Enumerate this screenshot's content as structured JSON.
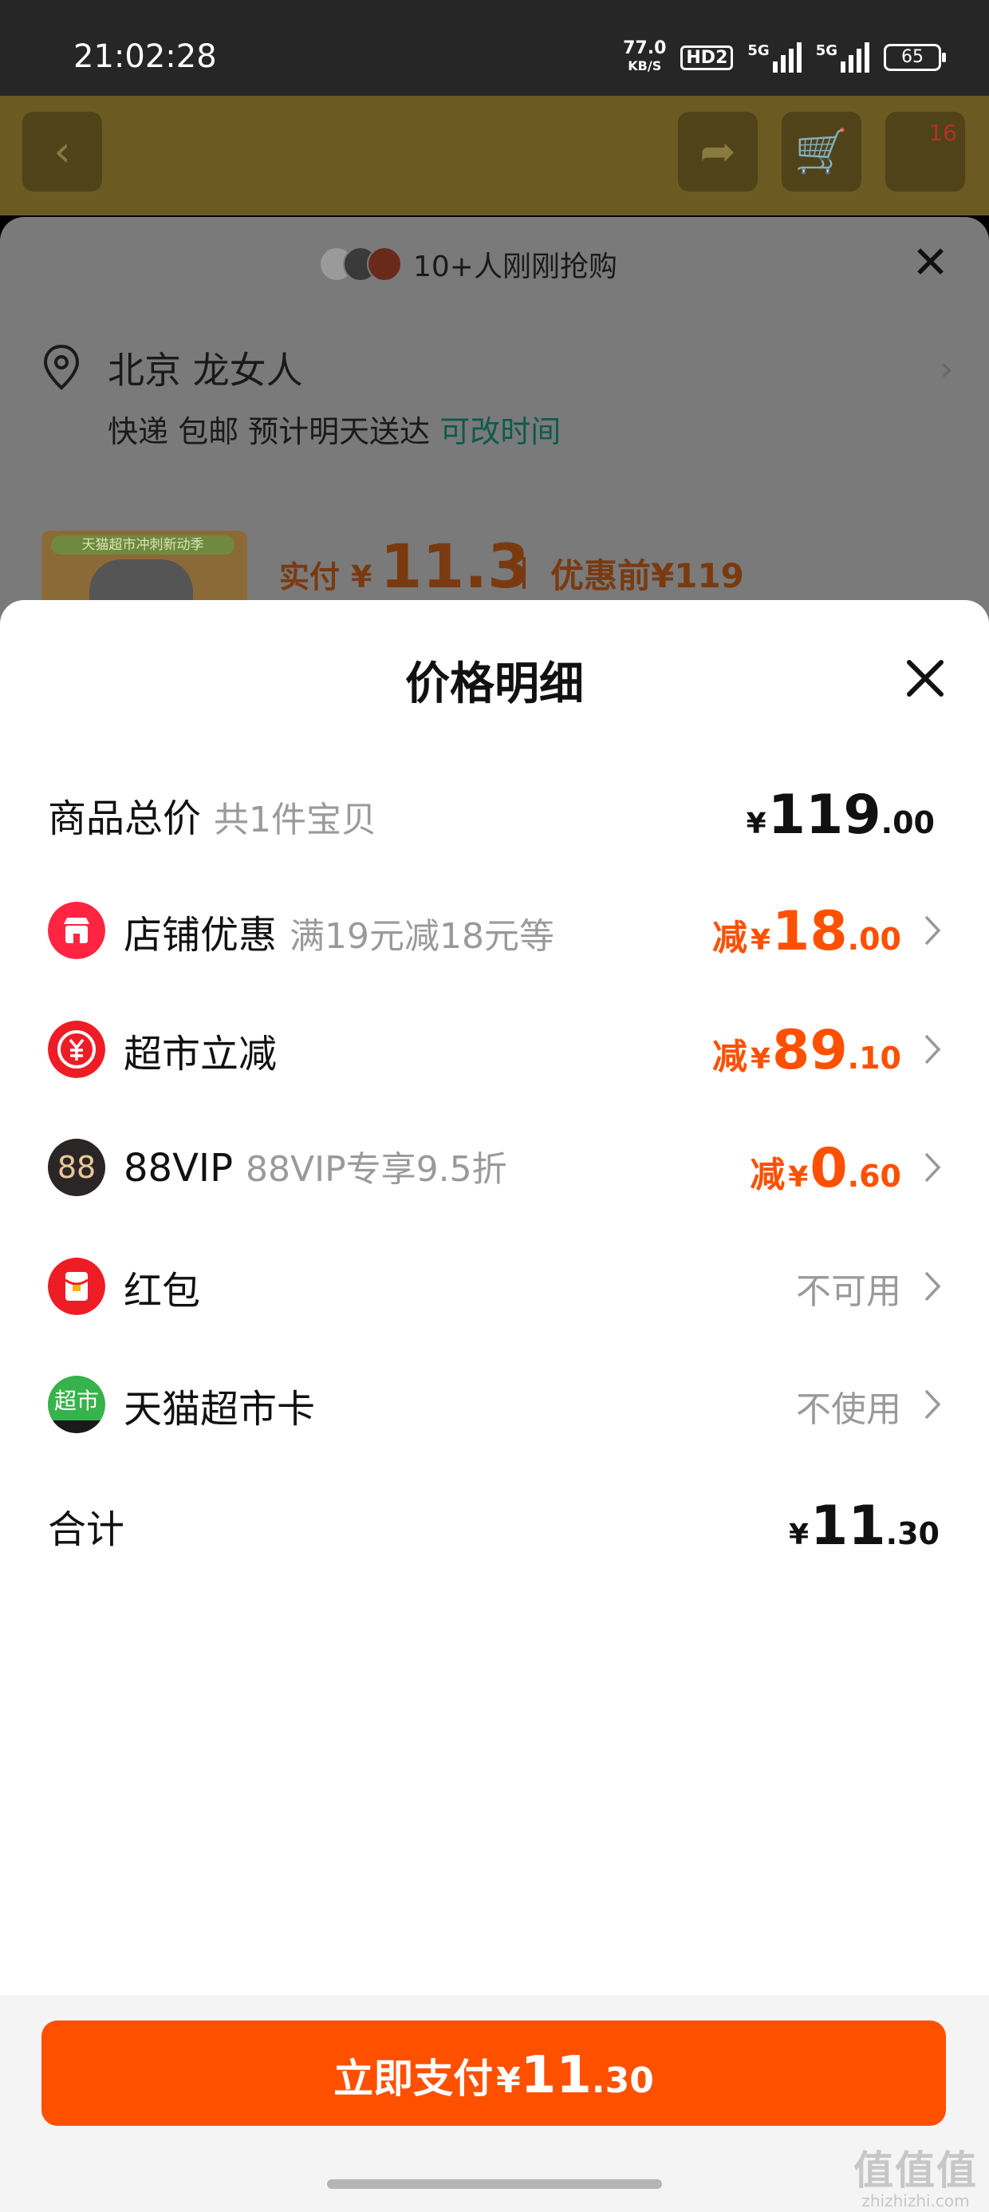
{
  "status_bar": {
    "time": "21:02:28",
    "net_speed": "77.0",
    "net_unit": "KB/S",
    "hd": "HD2",
    "sim1": "5G",
    "sim2": "5G",
    "battery": "65"
  },
  "top_bar": {
    "cart_count": "16",
    "icons": [
      "back-icon",
      "share-icon",
      "cart-icon"
    ]
  },
  "sheet_behind": {
    "buyers_text": "10+人刚刚抢购",
    "address_title": "北京 龙女人",
    "delivery_text": "快递 包邮 预计明天送达",
    "change_time": "可改时间",
    "product_tag": "天猫超市冲刺新动季",
    "real_price_label": "实付",
    "real_price_yen": "¥",
    "real_price_value": "11.3",
    "before_price": "优惠前¥119"
  },
  "price_detail": {
    "title": "价格明细",
    "rows": [
      {
        "label": "商品总价",
        "sub": "共1件宝贝",
        "prefix": "",
        "yen": "¥",
        "int": "119",
        "dec": ".00",
        "color": "#111111"
      },
      {
        "label": "店铺优惠",
        "sub": "满19元减18元等",
        "prefix": "减",
        "yen": "¥",
        "int": "18",
        "dec": ".00",
        "icon": "shop-icon",
        "icon_color": "#ff2442",
        "color": "#ff5000"
      },
      {
        "label": "超市立减",
        "sub": "",
        "prefix": "减",
        "yen": "¥",
        "int": "89",
        "dec": ".10",
        "icon": "yuan-coin-icon",
        "icon_color": "#ee1c25",
        "color": "#ff5000"
      },
      {
        "label": "88VIP",
        "sub": "88VIP专享9.5折",
        "prefix": "减",
        "yen": "¥",
        "int": "0",
        "dec": ".60",
        "icon": "88vip-icon",
        "icon_text": "88",
        "icon_color": "#2b2626",
        "color": "#ff5000"
      },
      {
        "label": "红包",
        "value": "不可用",
        "icon": "red-packet-icon",
        "icon_color": "#ee1c25"
      },
      {
        "label": "天猫超市卡",
        "value": "不使用",
        "icon": "tmall-supermarket-card-icon",
        "icon_text": "超市",
        "icon_color": "#36b34a"
      }
    ],
    "total_label": "合计",
    "total_yen": "¥",
    "total_int": "11",
    "total_dec": ".30"
  },
  "pay_button": {
    "label": "立即支付",
    "yen": "¥",
    "int": "11",
    "dec": ".30",
    "color": "#ff5000"
  },
  "watermark": {
    "top": "值值值",
    "sub": "zhizhizhi.com"
  }
}
